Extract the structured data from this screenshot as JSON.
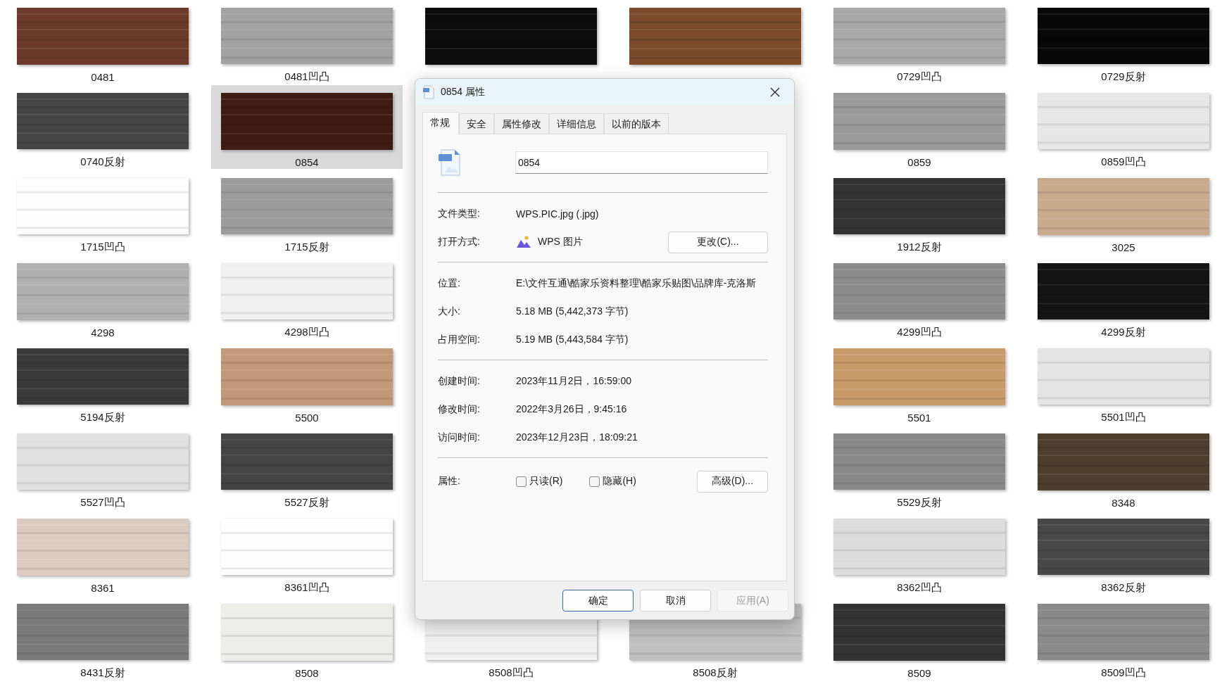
{
  "grid": {
    "rows": [
      [
        {
          "label": "0481",
          "color": "#6b3a2a",
          "selected": false
        },
        {
          "label": "0481凹凸",
          "color": "#a2a2a2",
          "selected": false
        },
        {
          "color": "#0c0c0c",
          "selected": false
        },
        {
          "color": "#7a4a2a",
          "selected": false
        },
        {
          "label": "0729凹凸",
          "color": "#a8a8a8",
          "selected": false
        },
        {
          "label": "0729反射",
          "color": "#080808",
          "selected": false
        }
      ],
      [
        {
          "label": "0740反射",
          "color": "#454545",
          "selected": false
        },
        {
          "label": "0854",
          "color": "#3e1c14",
          "selected": true
        },
        null,
        null,
        {
          "label": "0859",
          "color": "#9a9a9a",
          "selected": false
        },
        {
          "label": "0859凹凸",
          "color": "#e6e6e6",
          "selected": false
        }
      ],
      [
        {
          "label": "1715凹凸",
          "color": "#fdfdfd",
          "selected": false
        },
        {
          "label": "1715反射",
          "color": "#9c9c9c",
          "selected": false
        },
        null,
        null,
        {
          "label": "1912反射",
          "color": "#333333",
          "selected": false
        },
        {
          "label": "3025",
          "color": "#c8aa8c",
          "selected": false
        }
      ],
      [
        {
          "label": "4298",
          "color": "#b0b0b0",
          "selected": false
        },
        {
          "label": "4298凹凸",
          "color": "#f0f0f0",
          "selected": false
        },
        null,
        null,
        {
          "label": "4299凹凸",
          "color": "#8c8c8c",
          "selected": false
        },
        {
          "label": "4299反射",
          "color": "#141414",
          "selected": false
        }
      ],
      [
        {
          "label": "5194反射",
          "color": "#3a3a3a",
          "selected": false
        },
        {
          "label": "5500",
          "color": "#c09a78",
          "selected": false
        },
        null,
        null,
        {
          "label": "5501",
          "color": "#c89a68",
          "selected": false
        },
        {
          "label": "5501凹凸",
          "color": "#e4e4e4",
          "selected": false
        }
      ],
      [
        {
          "label": "5527凹凸",
          "color": "#e0e0e0",
          "selected": false
        },
        {
          "label": "5527反射",
          "color": "#444444",
          "selected": false
        },
        null,
        null,
        {
          "label": "5529反射",
          "color": "#888888",
          "selected": false
        },
        {
          "label": "8348",
          "color": "#4e3e2e",
          "selected": false
        }
      ],
      [
        {
          "label": "8361",
          "color": "#dcccc0",
          "selected": false
        },
        {
          "label": "8361凹凸",
          "color": "#fefefe",
          "selected": false
        },
        null,
        null,
        {
          "label": "8362凹凸",
          "color": "#dcdcdc",
          "selected": false
        },
        {
          "label": "8362反射",
          "color": "#484848",
          "selected": false
        }
      ],
      [
        {
          "label": "8431反射",
          "color": "#7a7a7a",
          "selected": false
        },
        {
          "label": "8508",
          "color": "#ecece8",
          "selected": false
        },
        {
          "label": "8508凹凸",
          "color": "#f0f0f0",
          "selected": false
        },
        {
          "label": "8508反射",
          "color": "#c0c0c0",
          "selected": false
        },
        {
          "label": "8509",
          "color": "#333333",
          "selected": false
        },
        {
          "label": "8509凹凸",
          "color": "#8a8a8a",
          "selected": false
        }
      ]
    ]
  },
  "dialog": {
    "title": "0854 属性",
    "tabs": [
      {
        "label": "常规",
        "selected": true
      },
      {
        "label": "安全",
        "selected": false
      },
      {
        "label": "属性修改",
        "selected": false
      },
      {
        "label": "详细信息",
        "selected": false
      },
      {
        "label": "以前的版本",
        "selected": false
      }
    ],
    "file_name": {
      "value": "0854"
    },
    "sections": [
      [
        {
          "kind": "text",
          "label": "文件类型:",
          "value": "WPS.PIC.jpg (.jpg)"
        },
        {
          "kind": "app",
          "label": "打开方式:",
          "value": "WPS 图片",
          "button": "更改(C)..."
        }
      ],
      [
        {
          "kind": "text",
          "label": "位置:",
          "value": "E:\\文件互通\\酷家乐资料整理\\酷家乐贴图\\品牌库-克洛斯"
        },
        {
          "kind": "text",
          "label": "大小:",
          "value": "5.18 MB (5,442,373 字节)"
        },
        {
          "kind": "text",
          "label": "占用空间:",
          "value": "5.19 MB (5,443,584 字节)"
        }
      ],
      [
        {
          "kind": "text",
          "label": "创建时间:",
          "value": "2023年11月2日，16:59:00"
        },
        {
          "kind": "text",
          "label": "修改时间:",
          "value": "2022年3月26日，9:45:16"
        },
        {
          "kind": "text",
          "label": "访问时间:",
          "value": "2023年12月23日，18:09:21"
        }
      ]
    ],
    "attributes": {
      "label": "属性:",
      "checkboxes": [
        {
          "label": "只读(R)",
          "checked": false
        },
        {
          "label": "隐藏(H)",
          "checked": false
        }
      ],
      "button": "高级(D)..."
    },
    "buttons": [
      {
        "label": "确定",
        "default": true,
        "disabled": false
      },
      {
        "label": "取消",
        "default": false,
        "disabled": false
      },
      {
        "label": "应用(A)",
        "default": false,
        "disabled": true
      }
    ]
  }
}
